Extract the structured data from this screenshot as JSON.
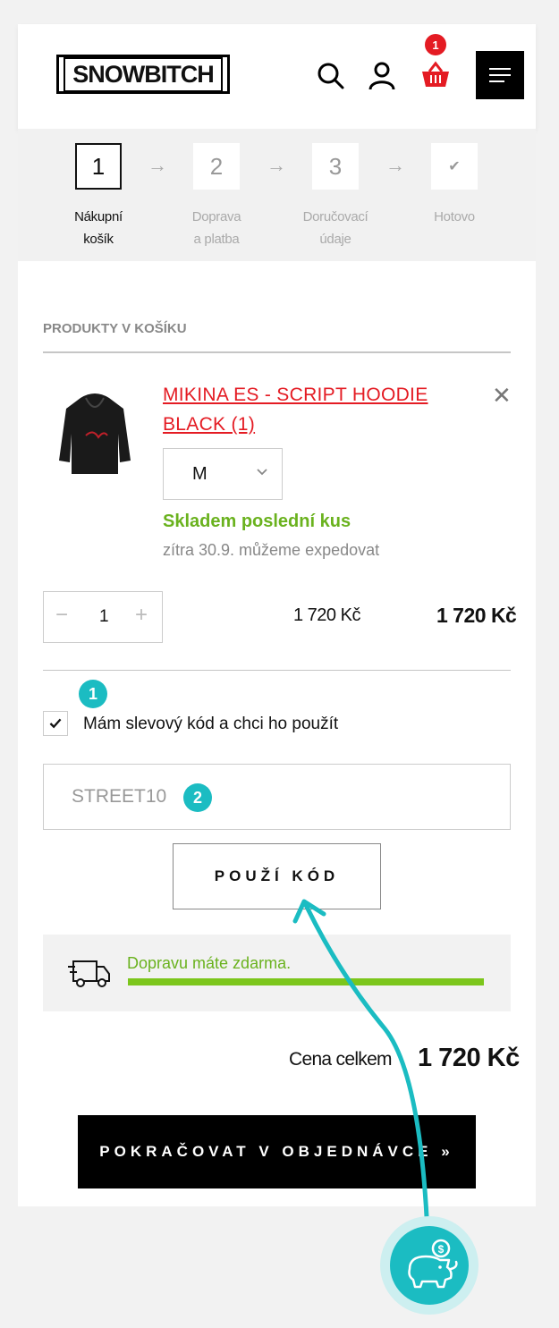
{
  "brand": {
    "logo_text": "SNOWBITCH"
  },
  "header": {
    "cart_count": "1"
  },
  "steps": [
    {
      "number": "1",
      "line1": "Nákupní",
      "line2": "košík",
      "active": true
    },
    {
      "number": "2",
      "line1": "Doprava",
      "line2": "a platba",
      "active": false
    },
    {
      "number": "3",
      "line1": "Doručovací",
      "line2": "údaje",
      "active": false
    },
    {
      "number": "✔",
      "line1": "Hotovo",
      "line2": "",
      "active": false
    }
  ],
  "cart": {
    "section_title": "PRODUKTY V KOŠÍKU",
    "item": {
      "name_line1": "MIKINA ES - SCRIPT HOODIE",
      "name_line2": "BLACK (1)",
      "size": "M",
      "stock_status": "Skladem poslední kus",
      "expedite_note": "zítra 30.9. můžeme expedovat",
      "quantity": "1",
      "unit_price": "1 720 Kč",
      "line_total": "1 720 Kč"
    }
  },
  "discount": {
    "checkbox_label": "Mám slevový kód a chci ho použít",
    "checked": true,
    "code_value": "STREET10",
    "apply_label": "POUŽÍ KÓD"
  },
  "shipping": {
    "message": "Dopravu máte zdarma.",
    "progress": 1.0
  },
  "summary": {
    "total_label": "Cena celkem",
    "total_value": "1 720 Kč"
  },
  "continue_label": "POKRAČOVAT V OBJEDNÁVCE »",
  "annotations": {
    "marker1": "1",
    "marker2": "2"
  },
  "colors": {
    "accent_red": "#e41b23",
    "stock_green": "#6ab21e",
    "teal": "#1bbcc2"
  }
}
